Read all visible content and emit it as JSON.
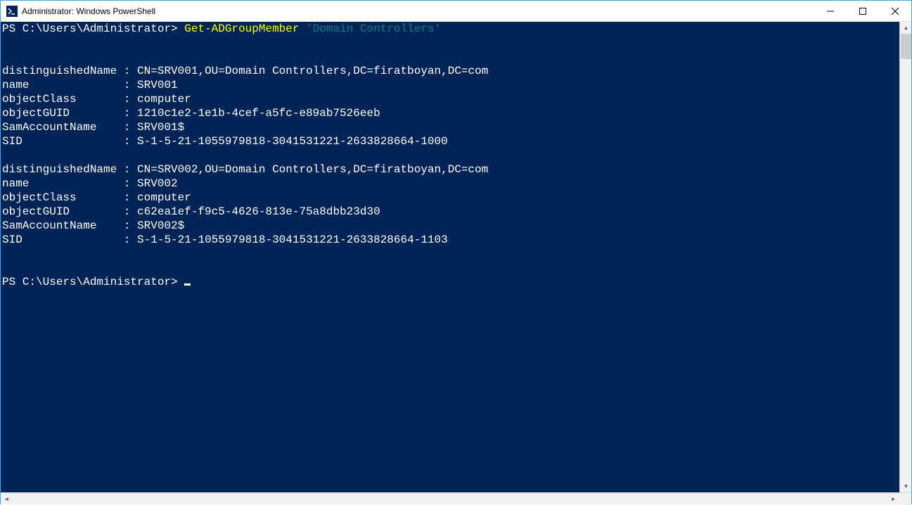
{
  "window": {
    "title": "Administrator: Windows PowerShell"
  },
  "prompt": {
    "text": "PS C:\\Users\\Administrator> ",
    "cmdlet": "Get-ADGroupMember",
    "argument": "'Domain Controllers'"
  },
  "results": [
    {
      "distinguishedName": "CN=SRV001,OU=Domain Controllers,DC=firatboyan,DC=com",
      "name": "SRV001",
      "objectClass": "computer",
      "objectGUID": "1210c1e2-1e1b-4cef-a5fc-e89ab7526eeb",
      "SamAccountName": "SRV001$",
      "SID": "S-1-5-21-1055979818-3041531221-2633828664-1000"
    },
    {
      "distinguishedName": "CN=SRV002,OU=Domain Controllers,DC=firatboyan,DC=com",
      "name": "SRV002",
      "objectClass": "computer",
      "objectGUID": "c62ea1ef-f9c5-4626-813e-75a8dbb23d30",
      "SamAccountName": "SRV002$",
      "SID": "S-1-5-21-1055979818-3041531221-2633828664-1103"
    }
  ],
  "labels": {
    "distinguishedName": "distinguishedName",
    "name": "name",
    "objectClass": "objectClass",
    "objectGUID": "objectGUID",
    "SamAccountName": "SamAccountName",
    "SID": "SID"
  },
  "prompt2": {
    "text": "PS C:\\Users\\Administrator> "
  }
}
